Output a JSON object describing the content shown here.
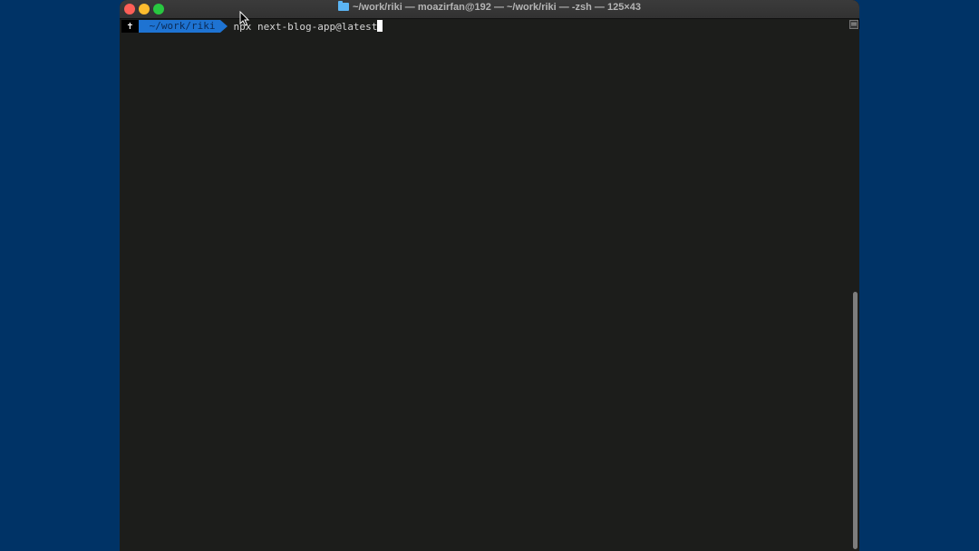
{
  "window": {
    "title": "~/work/riki — moazirfan@192 — ~/work/riki — -zsh — 125×43",
    "title_icon": "folder-icon"
  },
  "terminal": {
    "prompt": {
      "status_symbol": "✝",
      "directory": "~/work/riki"
    },
    "command": "npx next-blog-app@latest"
  },
  "colors": {
    "desktop_background": "#003366",
    "terminal_background": "#1c1d1b",
    "prompt_dir_segment": "#1e73d2",
    "close_button": "#fe5f57",
    "minimize_button": "#febc2e",
    "zoom_button": "#28c840"
  },
  "scrollbar": {
    "position_fraction": 1.0
  }
}
